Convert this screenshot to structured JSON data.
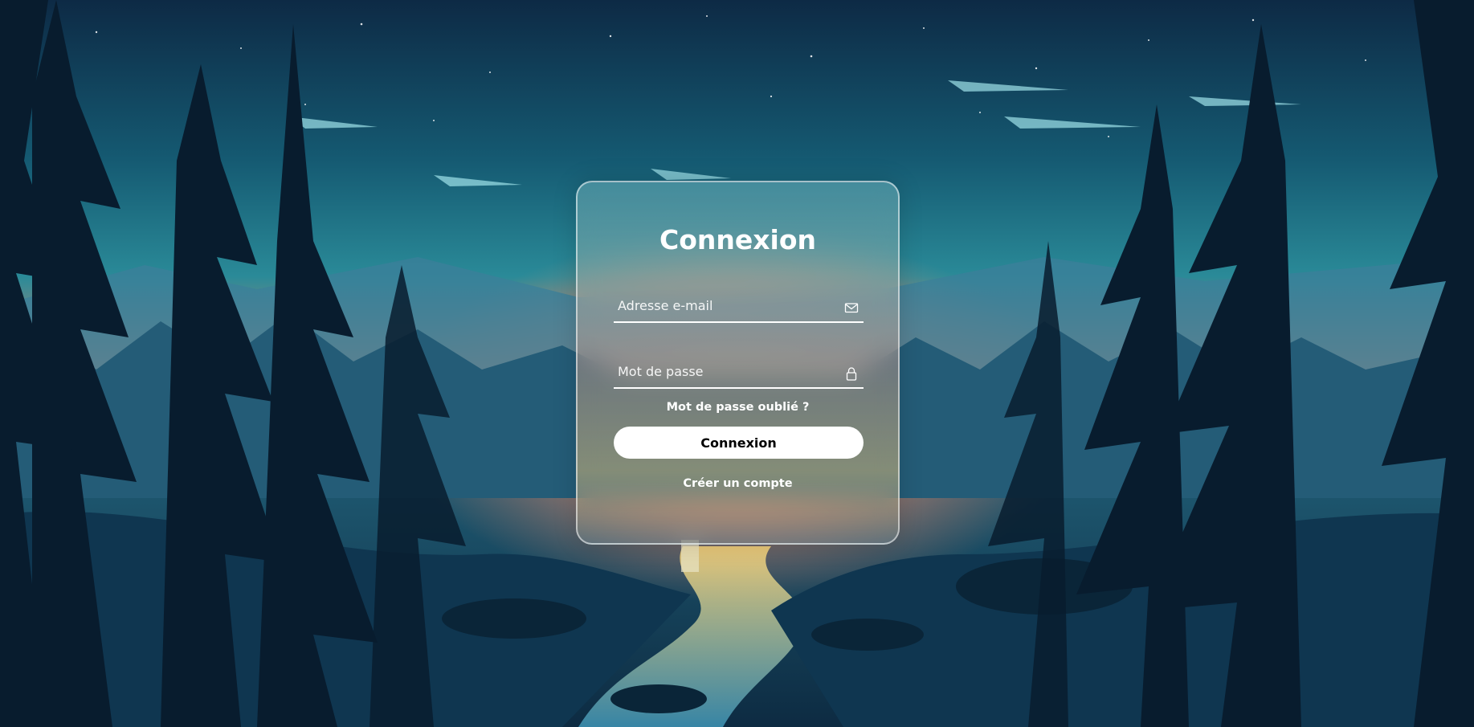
{
  "login": {
    "title": "Connexion",
    "email": {
      "placeholder": "Adresse e-mail",
      "value": "",
      "icon": "mail-icon"
    },
    "password": {
      "placeholder": "Mot de passe",
      "value": "",
      "icon": "lock-icon"
    },
    "forgot_label": "Mot de passe oublié ?",
    "submit_label": "Connexion",
    "register_label": "Créer un compte"
  },
  "colors": {
    "text": "#ffffff",
    "button_bg": "#ffffff",
    "button_text": "#000000"
  }
}
